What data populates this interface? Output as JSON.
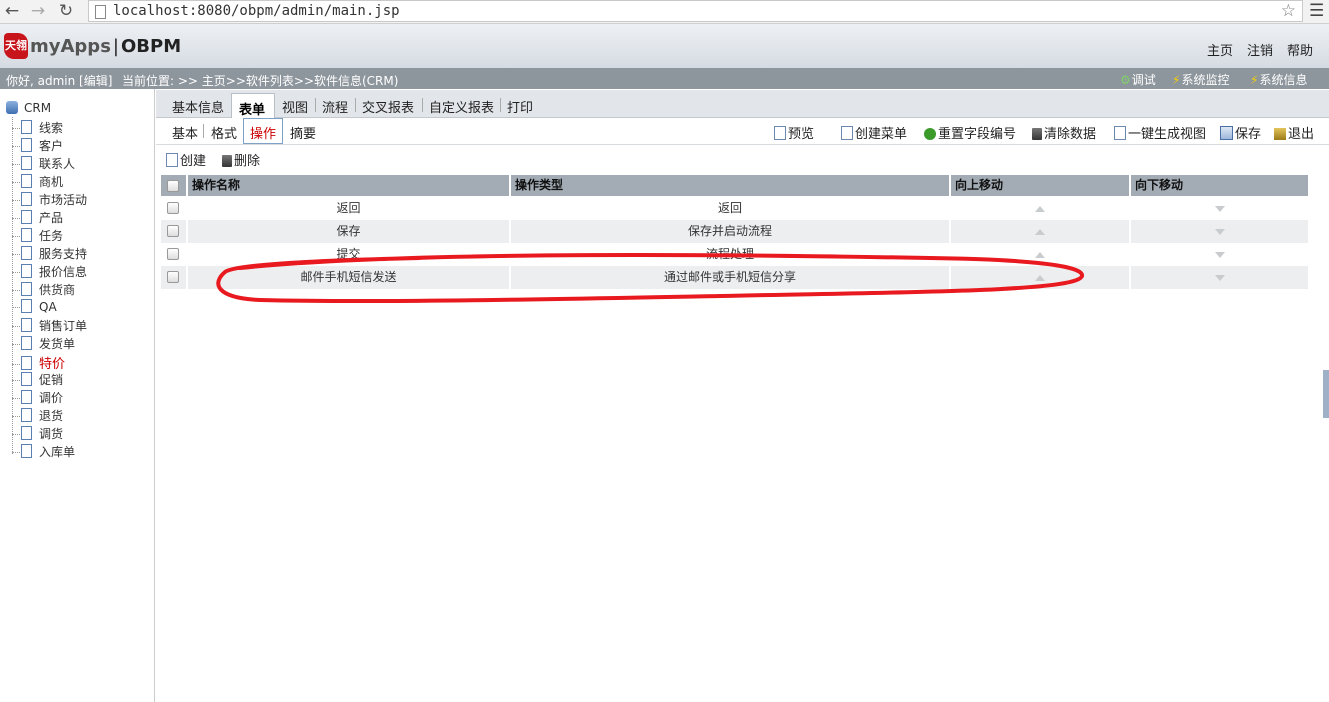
{
  "browser": {
    "url": "localhost:8080/obpm/admin/main.jsp",
    "back_icon": "back-arrow-icon",
    "forward_icon": "forward-arrow-icon",
    "reload_icon": "reload-icon",
    "star_icon": "star-icon",
    "menu_icon": "menu-icon"
  },
  "header": {
    "logo_badge": "天翎",
    "logo_app": "myApps",
    "logo_sep": "|",
    "logo_product": "OBPM",
    "links": [
      "主页",
      "注销",
      "帮助"
    ]
  },
  "statusbar": {
    "greeting": "你好, admin [编辑]",
    "location": "当前位置: >> 主页>>软件列表>>软件信息(CRM)",
    "tools": [
      "调试",
      "系统监控",
      "系统信息"
    ]
  },
  "sidebar": {
    "root": "CRM",
    "items": [
      "线索",
      "客户",
      "联系人",
      "商机",
      "市场活动",
      "产品",
      "任务",
      "服务支持",
      "报价信息",
      "供货商",
      "QA",
      "销售订单",
      "发货单",
      "特价",
      "促销",
      "调价",
      "退货",
      "调货",
      "入库单"
    ],
    "active_item": "特价"
  },
  "tabs": {
    "items": [
      "基本信息",
      "表单",
      "视图",
      "流程",
      "交叉报表",
      "自定义报表",
      "打印"
    ],
    "active": "表单"
  },
  "subtabs": {
    "items": [
      "基本",
      "格式",
      "操作",
      "摘要"
    ],
    "active": "操作"
  },
  "toolbar": {
    "preview": "预览",
    "create_menu": "创建菜单",
    "reset_field_no": "重置字段编号",
    "clear_data": "清除数据",
    "gen_view": "一键生成视图",
    "save": "保存",
    "exit": "退出"
  },
  "actions": {
    "create": "创建",
    "delete": "删除"
  },
  "table": {
    "columns": [
      "操作名称",
      "操作类型",
      "向上移动",
      "向下移动"
    ],
    "rows": [
      {
        "name": "返回",
        "type": "返回"
      },
      {
        "name": "保存",
        "type": "保存并启动流程"
      },
      {
        "name": "提交",
        "type": "流程处理"
      },
      {
        "name": "邮件手机短信发送",
        "type": "通过邮件或手机短信分享"
      }
    ]
  },
  "annotation": {
    "color": "#e8191f"
  }
}
